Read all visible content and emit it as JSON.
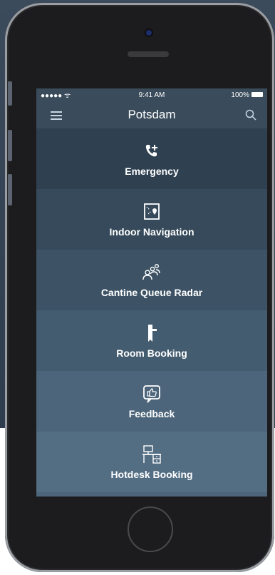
{
  "status_bar": {
    "signal": "●●●●● ᯤ",
    "time": "9:41 AM",
    "battery": "100%"
  },
  "nav": {
    "title": "Potsdam",
    "menu_icon": "hamburger-menu-icon",
    "search_icon": "search-icon"
  },
  "tiles": [
    {
      "label": "Emergency",
      "icon": "phone-plus-icon",
      "color": "#2f4151"
    },
    {
      "label": "Indoor Navigation",
      "icon": "map-pin-icon",
      "color": "#364a5b"
    },
    {
      "label": "Cantine Queue Radar",
      "icon": "people-icon",
      "color": "#3d5365"
    },
    {
      "label": "Room Booking",
      "icon": "door-handle-icon",
      "color": "#445c70"
    },
    {
      "label": "Feedback",
      "icon": "thumbs-up-icon",
      "color": "#4c657a"
    },
    {
      "label": "Hotdesk Booking",
      "icon": "desk-icon",
      "color": "#536d83"
    }
  ]
}
